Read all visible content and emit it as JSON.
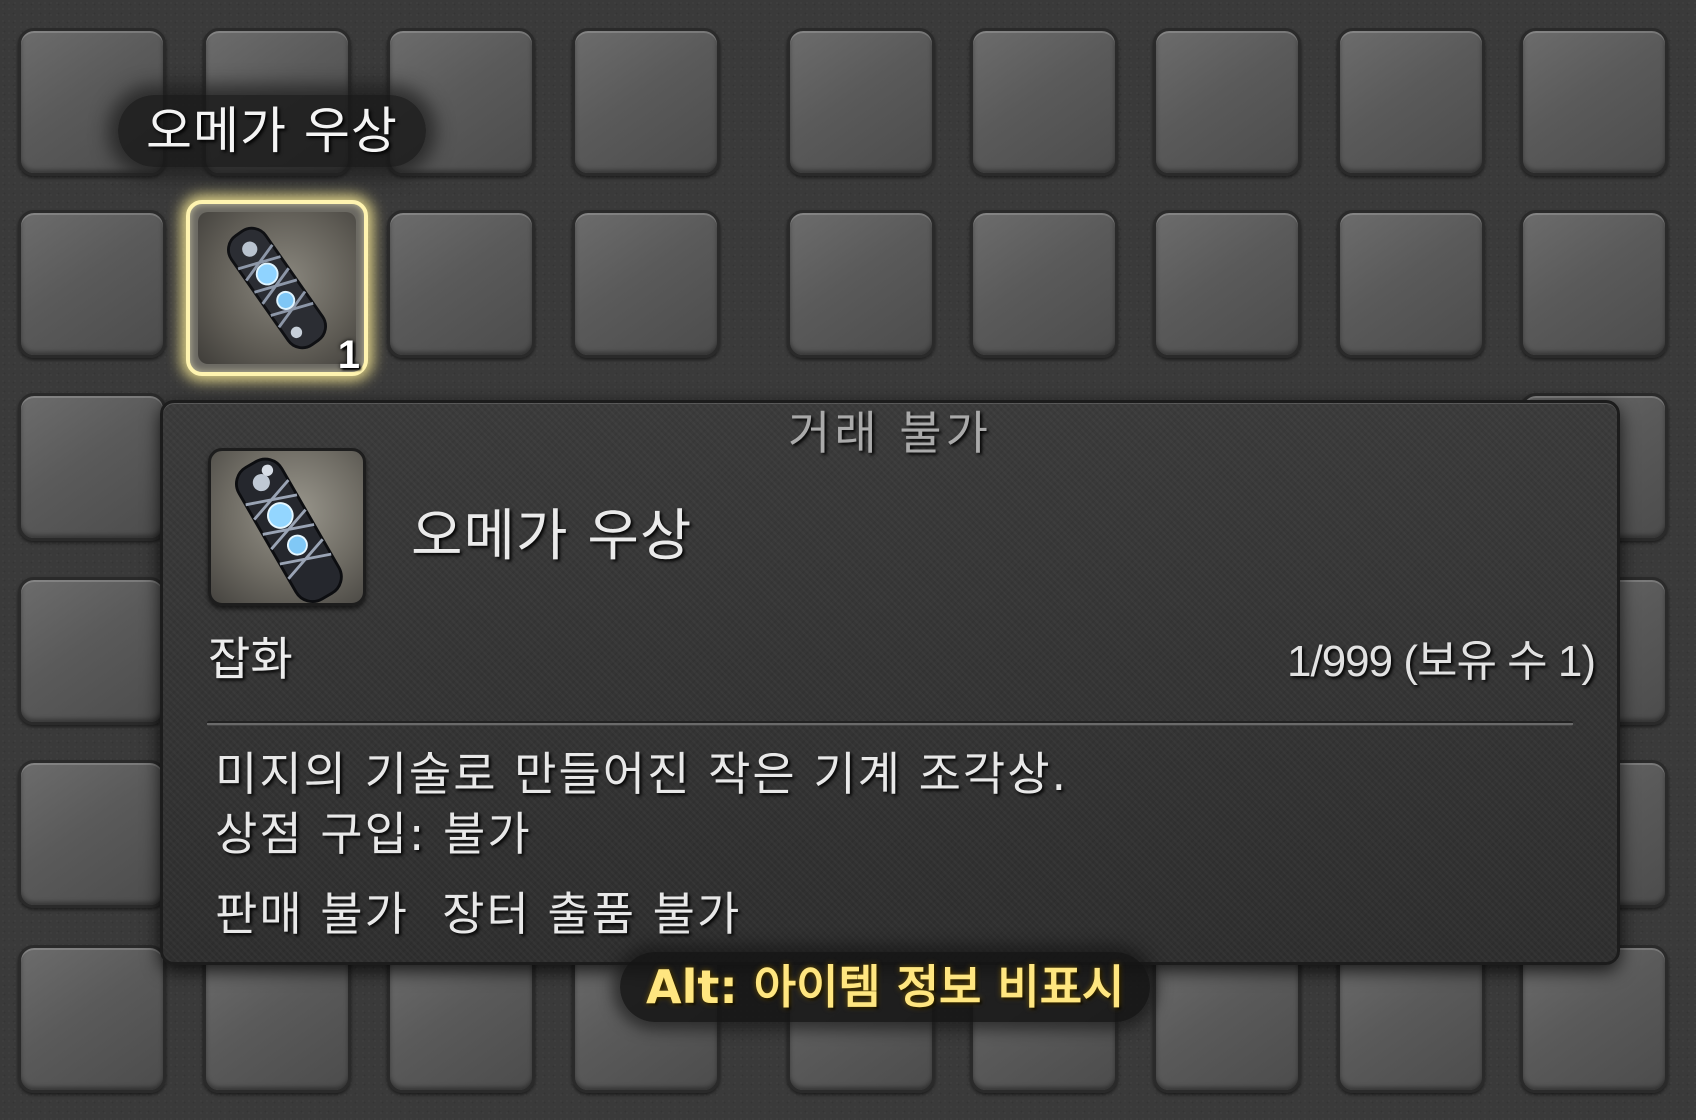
{
  "inventory": {
    "hover_label": "오메가 우상",
    "selected_slot_count": "1",
    "selected_item_icon": "mechanical-figurine-icon"
  },
  "tooltip": {
    "trade_status": "거래 불가",
    "item_name": "오메가 우상",
    "item_icon": "mechanical-figurine-icon",
    "category": "잡화",
    "stack_info": "1/999 (보유 수 1)",
    "description": "미지의 기술로 만들어진 작은 기계 조각상.",
    "shop_purchase": "상점 구입: 불가",
    "sell_market": "판매 불가  장터 출품 불가"
  },
  "hint": {
    "alt_toggle": "Alt: 아이템 정보 비표시",
    "accent_color": "#ffe680"
  }
}
